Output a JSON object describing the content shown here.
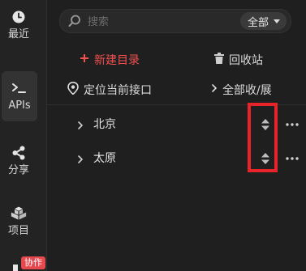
{
  "rail": {
    "items": [
      {
        "label": "最近",
        "icon": "clock-icon"
      },
      {
        "label": "APIs",
        "icon": "terminal-icon"
      },
      {
        "label": "分享",
        "icon": "share-icon"
      },
      {
        "label": "项目",
        "icon": "cubes-icon"
      }
    ],
    "collab_badge": "协作"
  },
  "search": {
    "placeholder": "搜索",
    "scope_label": "全部"
  },
  "toolbar": {
    "new_folder_label": "新建目录",
    "recycle_label": "回收站",
    "locate_label": "定位当前接口",
    "collapse_all_label": "全部收/展"
  },
  "tree": {
    "items": [
      {
        "label": "北京"
      },
      {
        "label": "太原"
      }
    ]
  },
  "colors": {
    "accent_red": "#f0504e",
    "highlight_red": "#e8232a"
  }
}
